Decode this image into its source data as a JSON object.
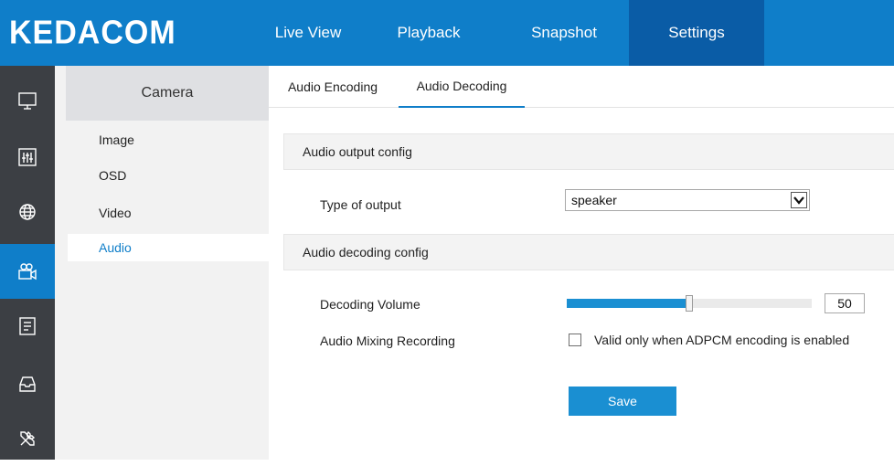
{
  "app": {
    "logo": "KEDACOM"
  },
  "nav": {
    "live_view": "Live View",
    "playback": "Playback",
    "snapshot": "Snapshot",
    "settings": "Settings",
    "active": "Settings"
  },
  "iconbar": {
    "icons": [
      "monitor-icon",
      "equalizer-icon",
      "network-globe-icon",
      "camera-icon",
      "event-list-icon",
      "storage-tray-icon",
      "tools-icon"
    ],
    "active": "camera-icon"
  },
  "submenu": {
    "header": "Camera",
    "items": [
      "Image",
      "OSD",
      "Video",
      "Audio"
    ],
    "active": "Audio"
  },
  "tabs": {
    "encoding": "Audio Encoding",
    "decoding": "Audio Decoding",
    "active": "Audio Decoding"
  },
  "output_section": {
    "title": "Audio output config",
    "type_label": "Type of output",
    "type_value": "speaker"
  },
  "decoding_section": {
    "title": "Audio decoding config",
    "volume_label": "Decoding Volume",
    "volume_value": "50",
    "volume_fraction": 0.5,
    "mixing_label": "Audio Mixing Recording",
    "mixing_note": "Valid only when ADPCM encoding is enabled",
    "mixing_checked": false
  },
  "actions": {
    "save_label": "Save"
  },
  "colors": {
    "brand": "#0f7ec9",
    "active_nav": "#0a5ca6",
    "sidebar": "#3c3f44",
    "button": "#1a8fd2"
  }
}
